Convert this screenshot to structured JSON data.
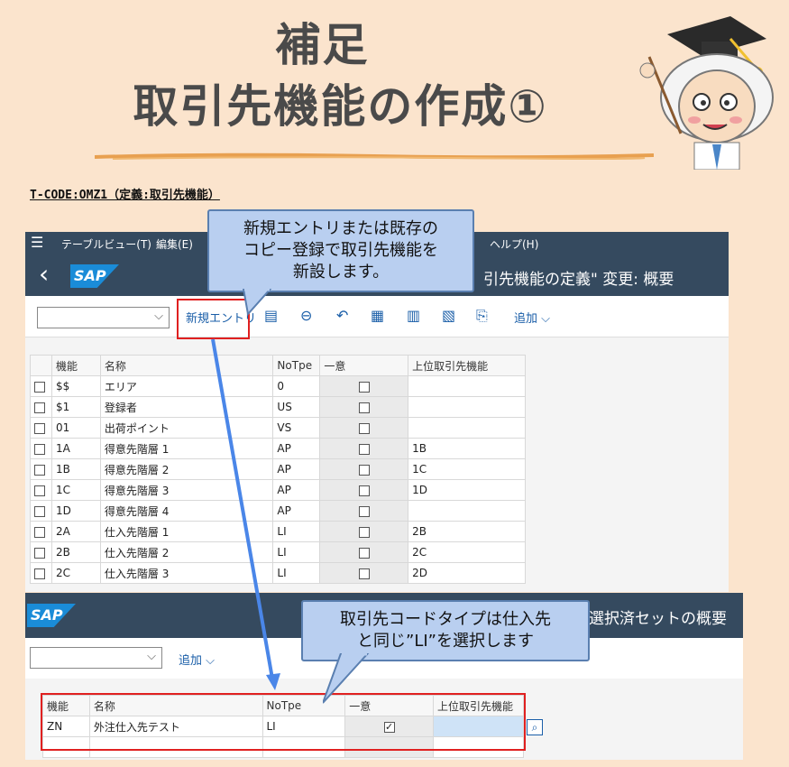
{
  "title": {
    "line1": "補足",
    "line2": "取引先機能の作成①"
  },
  "tcode": "T-CODE:OMZ1（定義:取引先機能）",
  "screen1": {
    "menu": [
      {
        "label": "テーブルビュー(T)"
      },
      {
        "label": "編集(E)"
      },
      {
        "label": "ヘルプ(H)"
      }
    ],
    "back_icon": "‹",
    "logo": "SAP",
    "window_title": "引先機能の定義\" 変更: 概要",
    "new_entry_label": "新規エントリ",
    "add_label": "追加",
    "icons": [
      "copy-icon",
      "minus-circle-icon",
      "undo-icon",
      "select-all-icon",
      "select-block-icon",
      "deselect-icon",
      "export-icon"
    ],
    "columns": [
      "機能",
      "名称",
      "NoTpe",
      "一意",
      "上位取引先機能"
    ],
    "rows": [
      {
        "code": "$$",
        "name": "エリア",
        "type": "0",
        "parent": ""
      },
      {
        "code": "$1",
        "name": "登録者",
        "type": "US",
        "parent": ""
      },
      {
        "code": "01",
        "name": "出荷ポイント",
        "type": "VS",
        "parent": ""
      },
      {
        "code": "1A",
        "name": "得意先階層 1",
        "type": "AP",
        "parent": "1B"
      },
      {
        "code": "1B",
        "name": "得意先階層 2",
        "type": "AP",
        "parent": "1C"
      },
      {
        "code": "1C",
        "name": "得意先階層 3",
        "type": "AP",
        "parent": "1D"
      },
      {
        "code": "1D",
        "name": "得意先階層 4",
        "type": "AP",
        "parent": ""
      },
      {
        "code": "2A",
        "name": "仕入先階層 1",
        "type": "LI",
        "parent": "2B"
      },
      {
        "code": "2B",
        "name": "仕入先階層 2",
        "type": "LI",
        "parent": "2C"
      },
      {
        "code": "2C",
        "name": "仕入先階層 3",
        "type": "LI",
        "parent": "2D"
      }
    ]
  },
  "screen2": {
    "logo": "SAP",
    "window_title": "選択済セットの概要",
    "add_label": "追加",
    "columns": [
      "機能",
      "名称",
      "NoTpe",
      "一意",
      "上位取引先機能"
    ],
    "row": {
      "code": "ZN",
      "name": "外注仕入先テスト",
      "type": "LI",
      "unique": true,
      "parent": ""
    }
  },
  "callout1": {
    "line1": "新規エントリまたは既存の",
    "line2": "コピー登録で取引先機能を",
    "line3": "新設します。"
  },
  "callout2": {
    "line1": "取引先コードタイプは仕入先",
    "line2": "と同じ”LI”を選択します"
  },
  "colors": {
    "sap_shell": "#354a5f",
    "callout_bg": "#b9cff0",
    "highlight": "#e02020",
    "arrow": "#4a86e8",
    "background": "#fbe4cd"
  }
}
